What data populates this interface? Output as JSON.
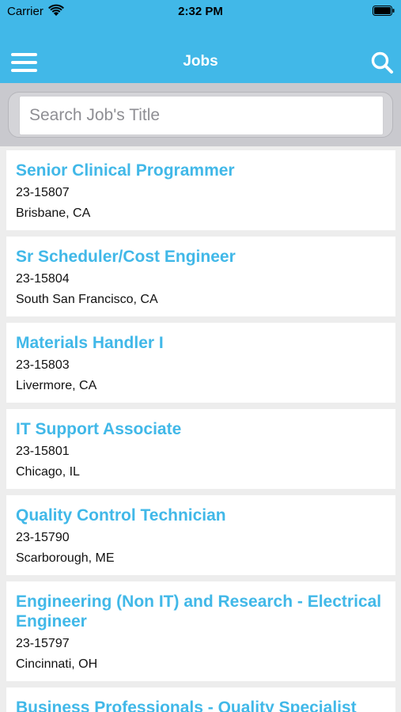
{
  "status_bar": {
    "carrier": "Carrier",
    "time": "2:32 PM"
  },
  "nav": {
    "title": "Jobs",
    "menu_icon": "hamburger-menu-icon",
    "search_icon": "search-icon"
  },
  "search": {
    "placeholder": "Search Job's Title",
    "value": ""
  },
  "jobs": [
    {
      "title": "Senior Clinical Programmer",
      "id": "23-15807",
      "location": "Brisbane, CA"
    },
    {
      "title": "Sr Scheduler/Cost Engineer",
      "id": "23-15804",
      "location": "South San Francisco, CA"
    },
    {
      "title": "Materials Handler I",
      "id": "23-15803",
      "location": "Livermore, CA"
    },
    {
      "title": "IT Support Associate",
      "id": "23-15801",
      "location": "Chicago, IL"
    },
    {
      "title": "Quality Control Technician",
      "id": "23-15790",
      "location": "Scarborough, ME"
    },
    {
      "title": "Engineering (Non IT) and Research - Electrical Engineer",
      "id": "23-15797",
      "location": "Cincinnati, OH"
    },
    {
      "title": "Business Professionals - Quality Specialist",
      "id": "",
      "location": ""
    }
  ],
  "colors": {
    "accent": "#41b8e8",
    "background": "#ededed",
    "card": "#ffffff"
  }
}
